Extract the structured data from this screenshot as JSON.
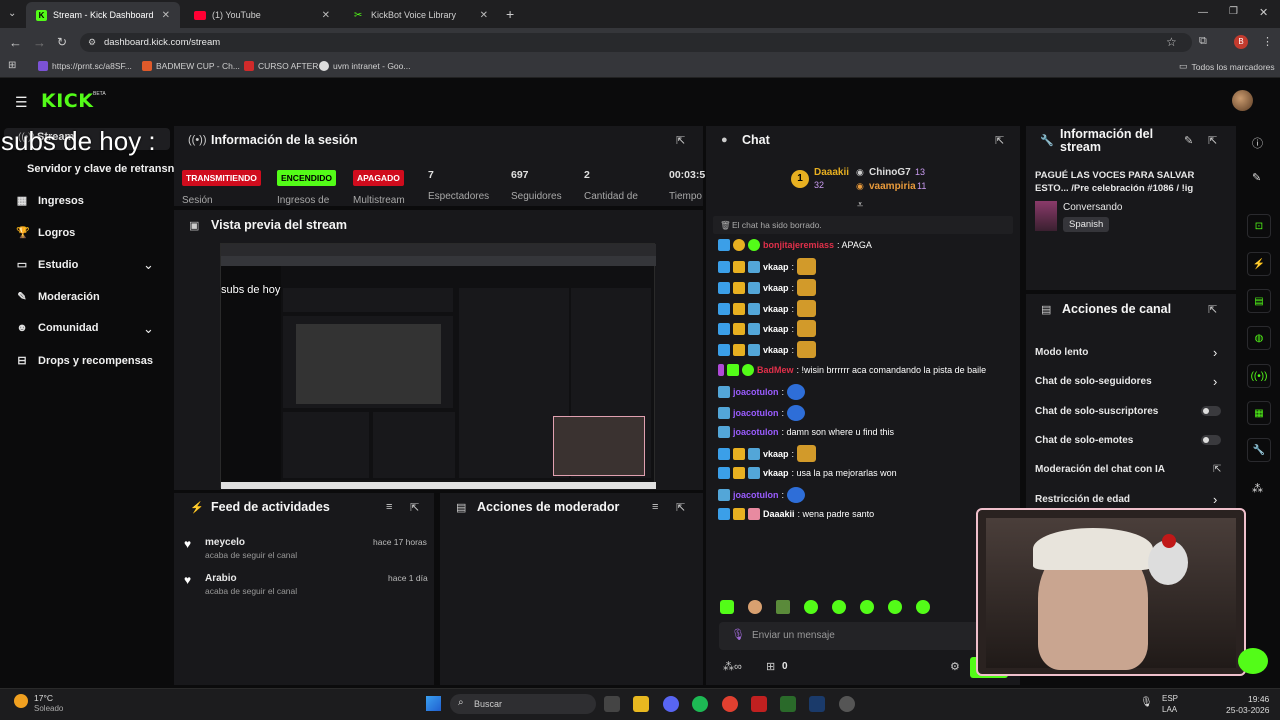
{
  "browser": {
    "tabs": [
      {
        "title": "Stream - Kick Dashboard"
      },
      {
        "title": "(1) YouTube"
      },
      {
        "title": "KickBot Voice Library"
      }
    ],
    "url": "dashboard.kick.com/stream",
    "bookmarks": [
      "https://prnt.sc/a8SF...",
      "BADMEW CUP - Ch...",
      "CURSO AFTER",
      "uvm intranet - Goo..."
    ],
    "all_bookmarks": "Todos los marcadores",
    "profile_initial": "B"
  },
  "brand": {
    "logo": "KICK",
    "beta": "BETA"
  },
  "overlay": {
    "big_text": "subs de hoy :",
    "stream_label": "Stream"
  },
  "sidebar": {
    "server_key": "Servidor y clave de retransn",
    "items": [
      {
        "label": "Ingresos",
        "icon": "bank-icon"
      },
      {
        "label": "Logros",
        "icon": "trophy-icon"
      },
      {
        "label": "Estudio",
        "icon": "studio-icon"
      },
      {
        "label": "Moderación",
        "icon": "wrench-icon"
      },
      {
        "label": "Comunidad",
        "icon": "community-icon"
      },
      {
        "label": "Drops y recompensas",
        "icon": "gift-icon"
      }
    ]
  },
  "session": {
    "title": "Información de la sesión",
    "status": [
      {
        "badge": "TRANSMITIENDO",
        "label": "Sesión"
      },
      {
        "badge": "ENCENDIDO",
        "label": "Ingresos de"
      },
      {
        "badge": "APAGADO",
        "label": "Multistream"
      }
    ],
    "stats": [
      {
        "value": "7",
        "label": "Espectadores"
      },
      {
        "value": "697",
        "label": "Seguidores"
      },
      {
        "value": "2",
        "label": "Cantidad de"
      },
      {
        "value": "00:03:5",
        "label": "Tiempo"
      }
    ]
  },
  "preview": {
    "title": "Vista previa del stream",
    "overlay_text": "subs de hoy"
  },
  "activity": {
    "title": "Feed de actividades",
    "items": [
      {
        "user": "meycelo",
        "action": "acaba de seguir el canal",
        "time": "hace 17 horas"
      },
      {
        "user": "Arabio",
        "action": "acaba de seguir el canal",
        "time": "hace 1 día"
      }
    ]
  },
  "mod_actions": {
    "title": "Acciones de moderador"
  },
  "chat": {
    "title": "Chat",
    "top": [
      {
        "name": "Daaakii",
        "count": "32",
        "rank": "1"
      },
      {
        "name": "ChinoG7",
        "count": "13"
      },
      {
        "name": "vaampiria",
        "count": "11"
      }
    ],
    "cleared": "El chat ha sido borrado.",
    "messages": [
      {
        "user": "bonjitajeremiass",
        "text": ": APAGA",
        "color": "#e0304a"
      },
      {
        "user": "vkaap",
        "text": ":",
        "color": "#ffffff",
        "emote": true
      },
      {
        "user": "vkaap",
        "text": ":",
        "color": "#ffffff",
        "emote": true
      },
      {
        "user": "vkaap",
        "text": ":",
        "color": "#ffffff",
        "emote": true
      },
      {
        "user": "vkaap",
        "text": ":",
        "color": "#ffffff",
        "emote": true
      },
      {
        "user": "vkaap",
        "text": ":",
        "color": "#ffffff",
        "emote": true
      },
      {
        "user": "BadMew",
        "text": ": !wisin brrrrrr aca comandando la pista de baile",
        "color": "#e0304a"
      },
      {
        "user": "joacotulon",
        "text": ":",
        "color": "#9a5cff",
        "emote2": true
      },
      {
        "user": "joacotulon",
        "text": ":",
        "color": "#9a5cff",
        "emote2": true
      },
      {
        "user": "joacotulon",
        "text": ": damn son where u find this",
        "color": "#9a5cff"
      },
      {
        "user": "vkaap",
        "text": ":",
        "color": "#ffffff",
        "emote": true
      },
      {
        "user": "vkaap",
        "text": ": usa la pa mejorarlas won",
        "color": "#ffffff"
      },
      {
        "user": "joacotulon",
        "text": ":",
        "color": "#9a5cff",
        "emote2": true
      },
      {
        "user": "Daaakii",
        "text": ": wena padre santo",
        "color": "#ffffff"
      }
    ],
    "placeholder": "Enviar un mensaje",
    "points": "0",
    "send": "Chat"
  },
  "stream_info": {
    "title": "Información del stream",
    "stream_title": "PAGUÉ LAS VOCES PARA SALVAR ESTO... /Pre celebración #1086 / !ig",
    "category": "Conversando",
    "language": "Spanish"
  },
  "channel_actions": {
    "title": "Acciones de canal",
    "items": [
      {
        "label": "Modo lento",
        "control": "chevron"
      },
      {
        "label": "Chat de solo-seguidores",
        "control": "chevron"
      },
      {
        "label": "Chat de solo-suscriptores",
        "control": "toggle"
      },
      {
        "label": "Chat de solo-emotes",
        "control": "toggle"
      },
      {
        "label": "Moderación del chat con IA",
        "control": "external"
      },
      {
        "label": "Restricción de edad",
        "control": "chevron"
      }
    ]
  },
  "taskbar": {
    "weather_temp": "17°C",
    "weather_desc": "Soleado",
    "search": "Buscar",
    "lang": "ESP",
    "lang2": "LAA",
    "time": "19:46",
    "date": "25-03-2026"
  },
  "colors": {
    "accent": "#53fc18",
    "live_red": "#d00c1d"
  }
}
